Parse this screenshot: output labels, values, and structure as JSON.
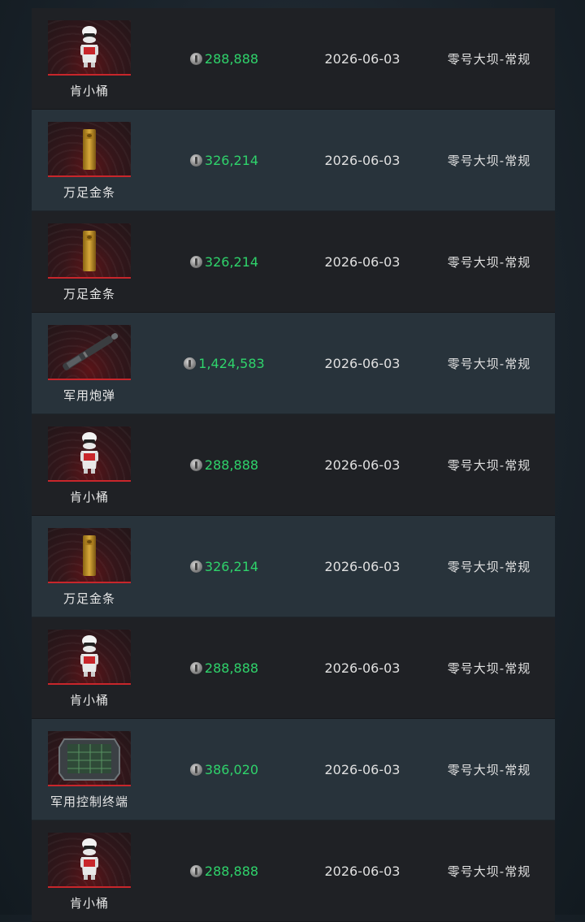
{
  "rows": [
    {
      "name": "肯小桶",
      "icon": "mascot-figure-icon",
      "price": "288,888",
      "date": "2026-06-03",
      "map": "零号大坝-常规"
    },
    {
      "name": "万足金条",
      "icon": "gold-bar-icon",
      "price": "326,214",
      "date": "2026-06-03",
      "map": "零号大坝-常规"
    },
    {
      "name": "万足金条",
      "icon": "gold-bar-icon",
      "price": "326,214",
      "date": "2026-06-03",
      "map": "零号大坝-常规"
    },
    {
      "name": "军用炮弹",
      "icon": "artillery-shell-icon",
      "price": "1,424,583",
      "date": "2026-06-03",
      "map": "零号大坝-常规"
    },
    {
      "name": "肯小桶",
      "icon": "mascot-figure-icon",
      "price": "288,888",
      "date": "2026-06-03",
      "map": "零号大坝-常规"
    },
    {
      "name": "万足金条",
      "icon": "gold-bar-icon",
      "price": "326,214",
      "date": "2026-06-03",
      "map": "零号大坝-常规"
    },
    {
      "name": "肯小桶",
      "icon": "mascot-figure-icon",
      "price": "288,888",
      "date": "2026-06-03",
      "map": "零号大坝-常规"
    },
    {
      "name": "军用控制终端",
      "icon": "control-terminal-icon",
      "price": "386,020",
      "date": "2026-06-03",
      "map": "零号大坝-常规"
    },
    {
      "name": "肯小桶",
      "icon": "mascot-figure-icon",
      "price": "288,888",
      "date": "2026-06-03",
      "map": "零号大坝-常规"
    }
  ],
  "colors": {
    "price": "#2fd36b",
    "rarity_border": "#c8262b",
    "row_dark": "#1f2125",
    "row_light": "#28333b"
  }
}
